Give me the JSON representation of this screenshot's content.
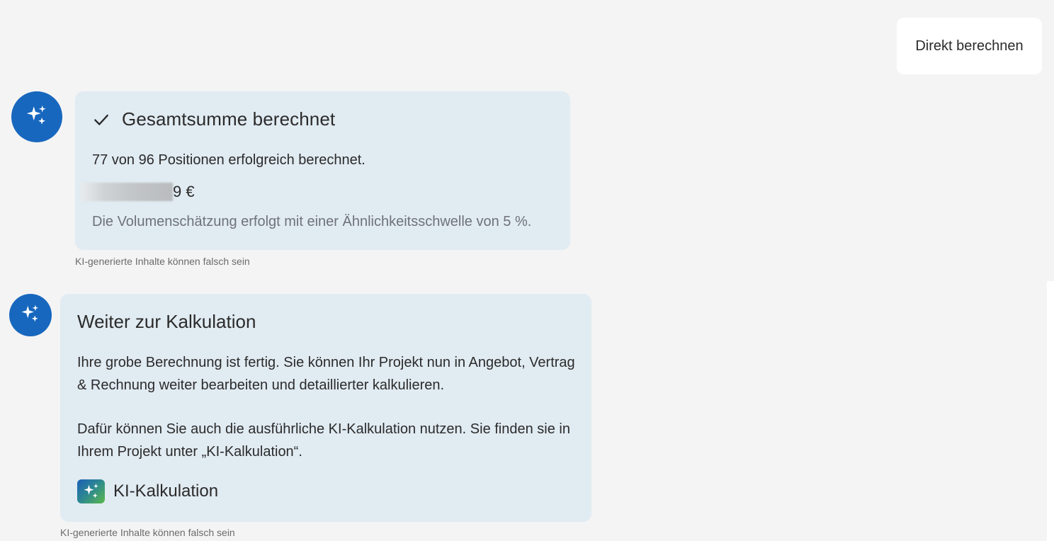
{
  "user_message": {
    "label": "Direkt berechnen"
  },
  "assistant_messages": [
    {
      "avatar_icon": "sparkles-icon",
      "status_icon": "check-icon",
      "title": "Gesamtsumme berechnet",
      "positions_text": "77 von 96 Positionen erfolgreich berechnet.",
      "amount_visible_suffix": "9 €",
      "hint": "Die Volumenschätzung erfolgt mit einer Ähnlichkeitsschwelle von 5 %.",
      "disclaimer": "KI-generierte Inhalte können falsch sein"
    },
    {
      "avatar_icon": "sparkles-icon",
      "title": "Weiter zur Kalkulation",
      "paragraph_1": "Ihre grobe Berechnung ist fertig. Sie können Ihr Projekt nun in Angebot, Vertrag & Rechnung weiter bearbeiten und detaillierter kalkulieren.",
      "paragraph_2": "Dafür können Sie auch die ausführliche KI-Kalkulation nutzen. Sie finden sie in Ihrem Projekt unter „KI-Kalkulation“.",
      "link_icon": "ki-kalkulation-app-icon",
      "link_label": "KI-Kalkulation",
      "disclaimer": "KI-generierte Inhalte können falsch sein"
    }
  ],
  "colors": {
    "background": "#f4f4f4",
    "avatar": "#1767be",
    "card": "#e1ebf2",
    "user_bubble": "#ffffff",
    "muted_text": "#6e7378"
  }
}
